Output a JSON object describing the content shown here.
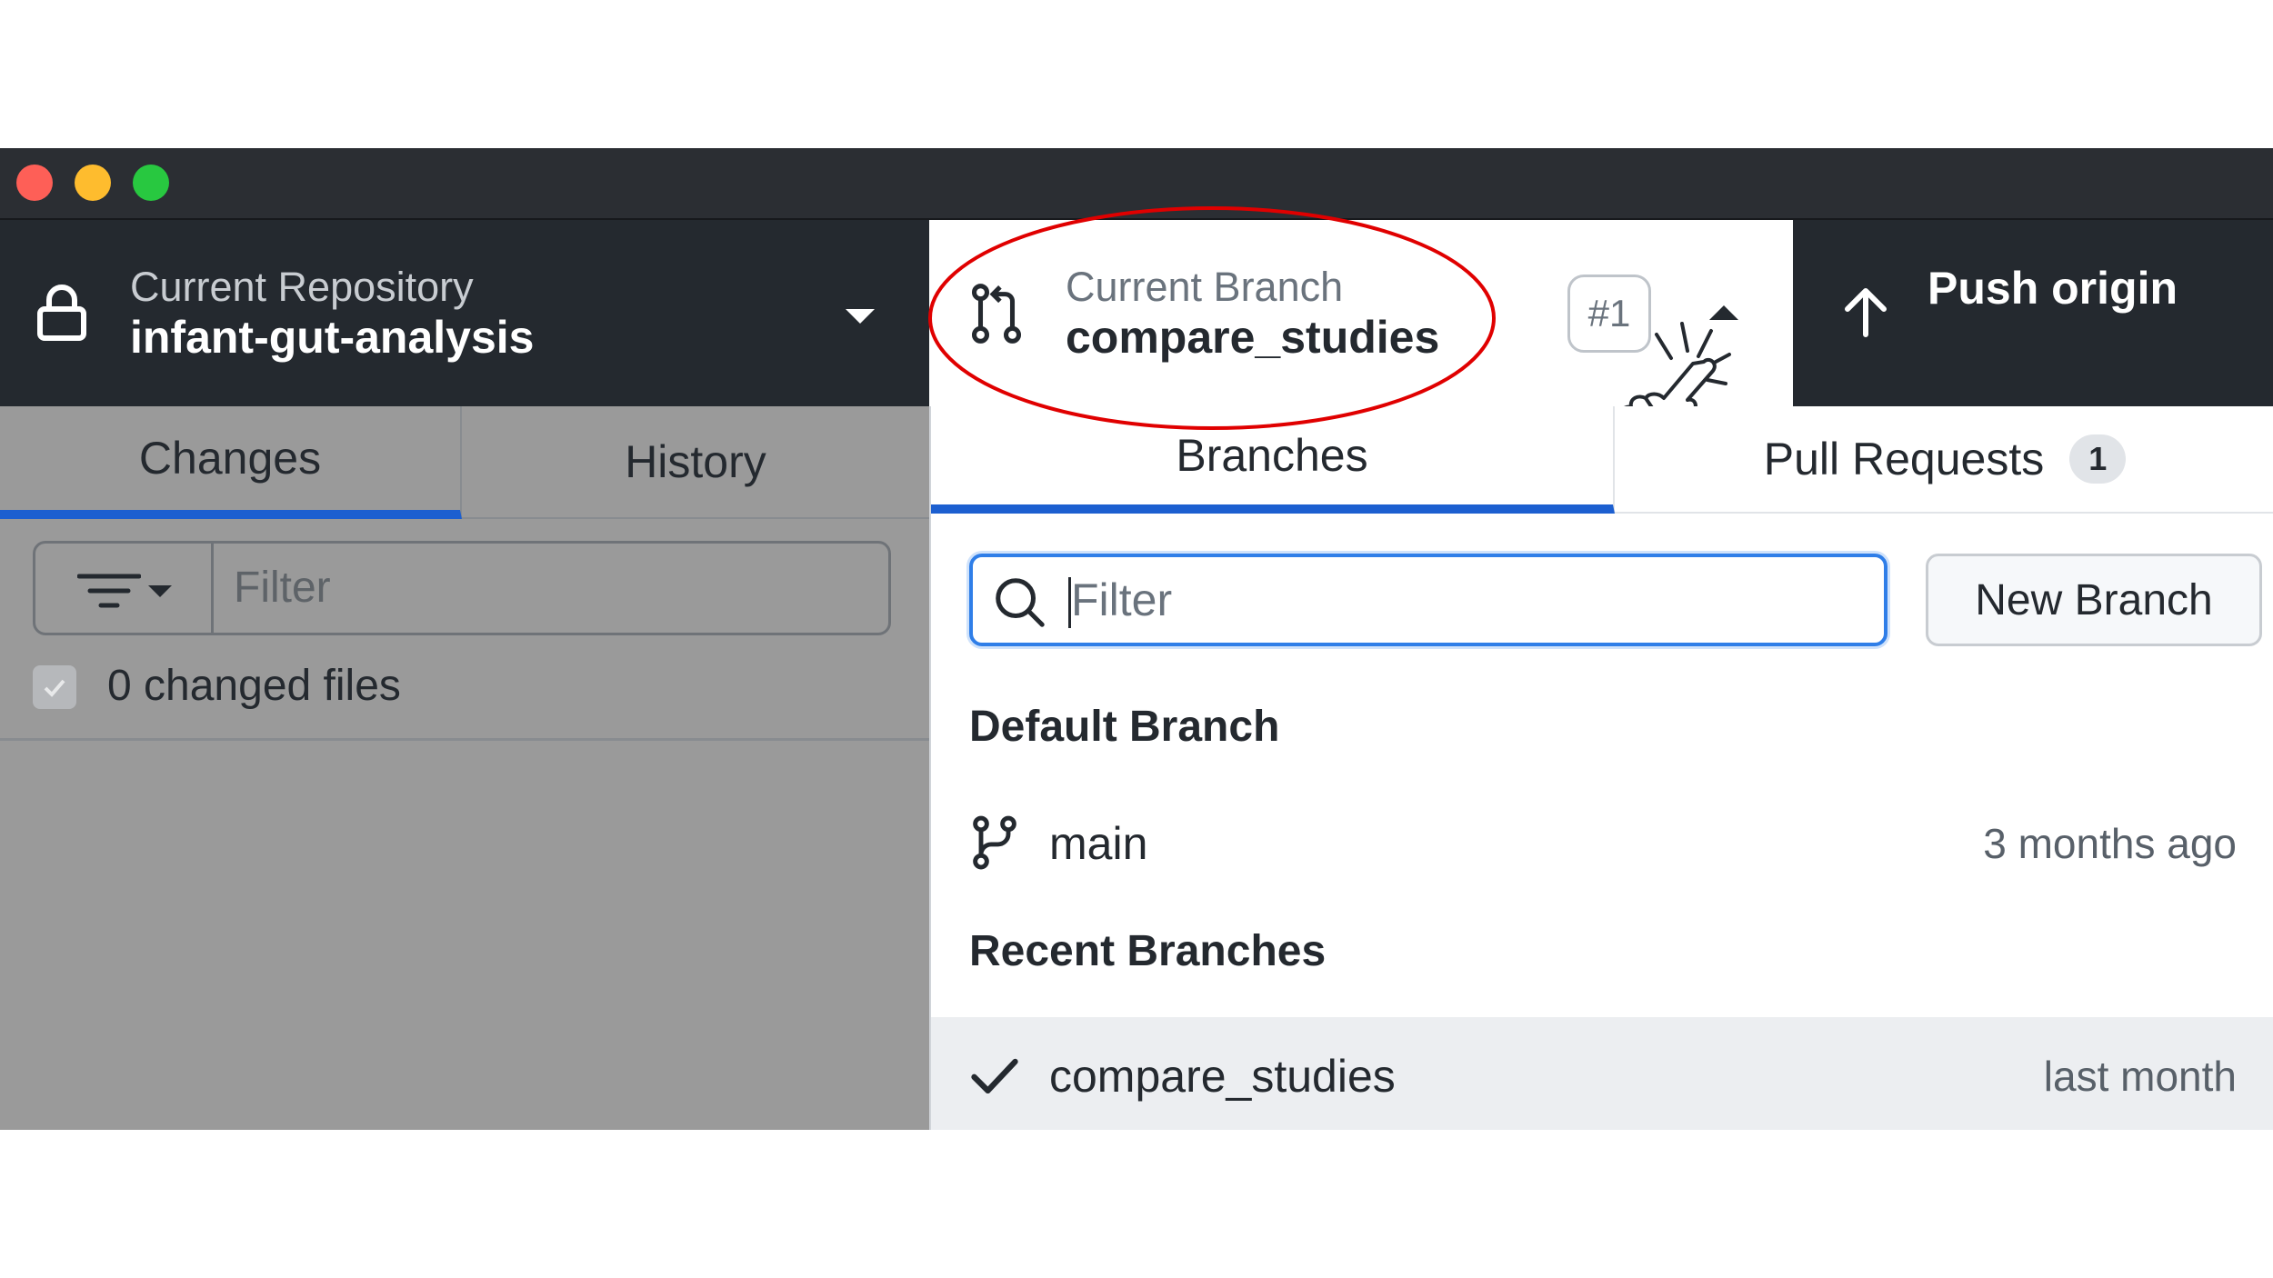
{
  "window": {
    "controls": [
      "close",
      "minimize",
      "zoom"
    ]
  },
  "repository": {
    "label": "Current Repository",
    "name": "infant-gut-analysis",
    "icon": "lock-icon"
  },
  "branch": {
    "label": "Current Branch",
    "name": "compare_studies",
    "pr_badge": "#1",
    "icon": "git-pull-request-icon"
  },
  "push": {
    "label": "Push origin",
    "icon": "arrow-up-icon"
  },
  "left_tabs": {
    "changes": "Changes",
    "history": "History"
  },
  "left_filter": {
    "placeholder": "Filter"
  },
  "changes_summary": "0 changed files",
  "dropdown": {
    "tabs": {
      "branches": "Branches",
      "pull_requests": "Pull Requests",
      "pull_requests_count": "1"
    },
    "filter_placeholder": "Filter",
    "new_branch": "New Branch",
    "default_section": "Default Branch",
    "recent_section": "Recent Branches",
    "default_branch": {
      "name": "main",
      "time": "3 months ago",
      "icon": "git-branch-icon"
    },
    "recent_branch": {
      "name": "compare_studies",
      "time": "last month",
      "icon": "check-icon"
    }
  },
  "colors": {
    "accent": "#1c5fd0",
    "annotation": "#e00000",
    "toolbar": "#24292f",
    "titlebar": "#2b2e33"
  }
}
